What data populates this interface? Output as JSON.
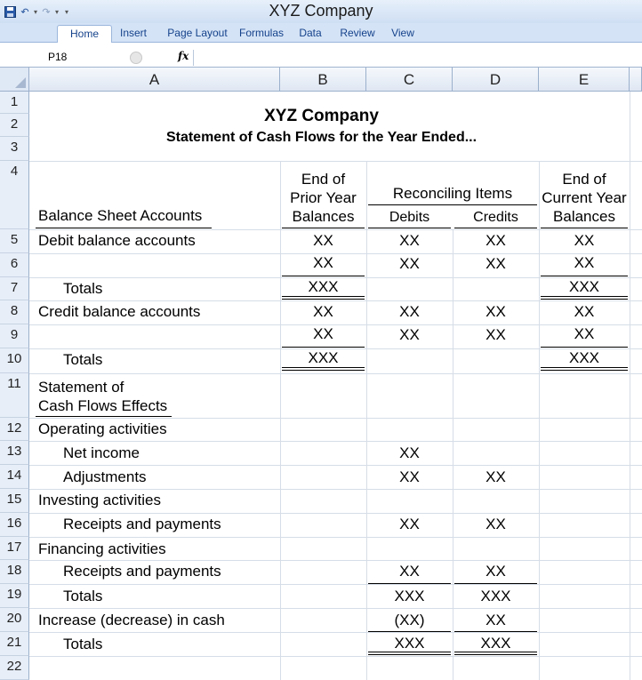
{
  "window": {
    "title": "XYZ Company"
  },
  "ribbon": {
    "tabs": [
      "Home",
      "Insert",
      "Page Layout",
      "Formulas",
      "Data",
      "Review",
      "View"
    ],
    "active_tab": "Home"
  },
  "formula_bar": {
    "name_box": "P18",
    "fx_label": "fx",
    "value": ""
  },
  "columns": [
    "A",
    "B",
    "C",
    "D",
    "E"
  ],
  "rows": [
    "1",
    "2",
    "3",
    "4",
    "5",
    "6",
    "7",
    "8",
    "9",
    "10",
    "11",
    "12",
    "13",
    "14",
    "15",
    "16",
    "17",
    "18",
    "19",
    "20",
    "21",
    "22"
  ],
  "sheet": {
    "title": "XYZ Company",
    "subtitle": "Statement of Cash Flows for the Year Ended...",
    "headers": {
      "col_a": "Balance Sheet Accounts",
      "col_b": [
        "End of",
        "Prior Year",
        "Balances"
      ],
      "reconciling": "Reconciling Items",
      "col_c": "Debits",
      "col_d": "Credits",
      "col_e": [
        "End of",
        "Current Year",
        "Balances"
      ]
    },
    "rows": {
      "r5": {
        "a": "Debit balance accounts",
        "b": "XX",
        "c": "XX",
        "d": "XX",
        "e": "XX"
      },
      "r6": {
        "b": "XX",
        "c": "XX",
        "d": "XX",
        "e": "XX"
      },
      "r7": {
        "a": "Totals",
        "b": "XXX",
        "e": "XXX"
      },
      "r8": {
        "a": "Credit balance accounts",
        "b": "XX",
        "c": "XX",
        "d": "XX",
        "e": "XX"
      },
      "r9": {
        "b": "XX",
        "c": "XX",
        "d": "XX",
        "e": "XX"
      },
      "r10": {
        "a": "Totals",
        "b": "XXX",
        "e": "XXX"
      },
      "r11": {
        "a": [
          "Statement of",
          "Cash Flows Effects"
        ]
      },
      "r12": {
        "a": "Operating activities"
      },
      "r13": {
        "a": "Net income",
        "c": "XX"
      },
      "r14": {
        "a": "Adjustments",
        "c": "XX",
        "d": "XX"
      },
      "r15": {
        "a": "Investing activities"
      },
      "r16": {
        "a": "Receipts and payments",
        "c": "XX",
        "d": "XX"
      },
      "r17": {
        "a": "Financing activities"
      },
      "r18": {
        "a": "Receipts and payments",
        "c": "XX",
        "d": "XX"
      },
      "r19": {
        "a": "Totals",
        "c": "XXX",
        "d": "XXX"
      },
      "r20": {
        "a": "Increase (decrease) in cash",
        "c": "(XX)",
        "d": "XX"
      },
      "r21": {
        "a": "Totals",
        "c": "XXX",
        "d": "XXX"
      }
    }
  },
  "colors": {
    "ribbon_bg": "#d4e3f6",
    "header_bg": "#e7eef8",
    "tab_text": "#15428b"
  },
  "icons": [
    "save-icon",
    "undo-icon",
    "redo-icon",
    "customize-qat-icon"
  ]
}
